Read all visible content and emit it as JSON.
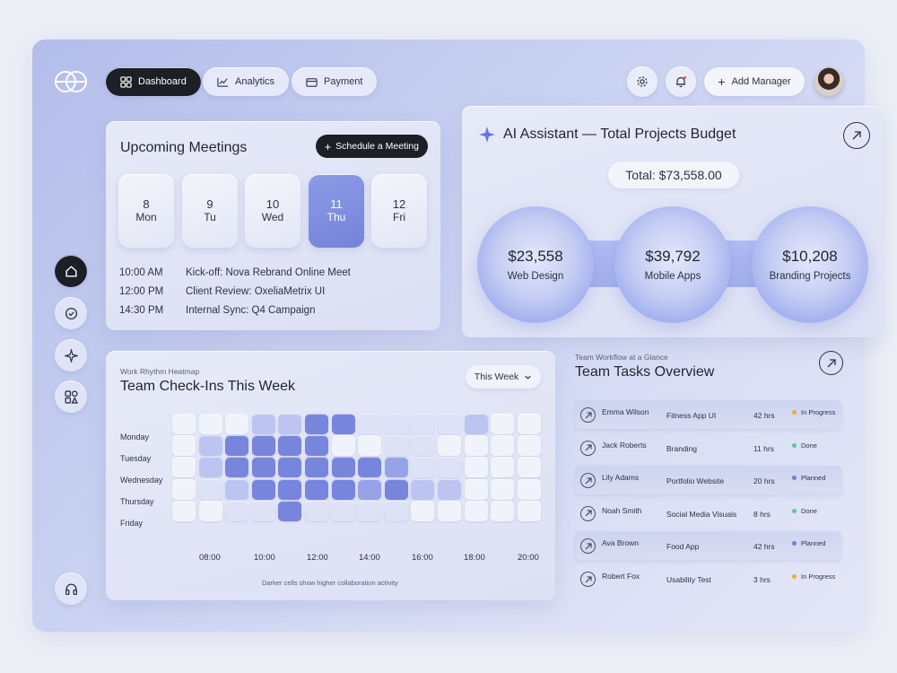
{
  "nav": {
    "dashboard": "Dashboard",
    "analytics": "Analytics",
    "payment": "Payment",
    "add_manager": "Add Manager"
  },
  "meetings": {
    "title": "Upcoming Meetings",
    "schedule_label": "Schedule a Meeting",
    "days": [
      {
        "num": "8",
        "name": "Mon"
      },
      {
        "num": "9",
        "name": "Tu"
      },
      {
        "num": "10",
        "name": "Wed"
      },
      {
        "num": "11",
        "name": "Thu",
        "selected": true
      },
      {
        "num": "12",
        "name": "Fri"
      }
    ],
    "items": [
      {
        "time": "10:00 AM",
        "title": "Kick-off: Nova Rebrand Online Meet"
      },
      {
        "time": "12:00 PM",
        "title": "Client Review: OxeliaMetrix UI"
      },
      {
        "time": "14:30 PM",
        "title": "Internal Sync: Q4 Campaign"
      }
    ]
  },
  "ai": {
    "title": "AI Assistant — Total Projects Budget",
    "total": "Total: $73,558.00",
    "bubbles": [
      {
        "amount": "$23,558",
        "label": "Web Design"
      },
      {
        "amount": "$39,792",
        "label": "Mobile Apps"
      },
      {
        "amount": "$10,208",
        "label": "Branding Projects"
      }
    ]
  },
  "heatmap": {
    "subtitle": "Work Rhythm Heatmap",
    "title": "Team Check-Ins This Week",
    "range": "This Week",
    "days": [
      "Monday",
      "Tuesday",
      "Wednesday",
      "Thursday",
      "Friday"
    ],
    "times": [
      "08:00",
      "10:00",
      "12:00",
      "14:00",
      "16:00",
      "18:00",
      "20:00"
    ],
    "note": "Darker cells show higher collaboration activity",
    "levels": [
      [
        0,
        0,
        0,
        2,
        2,
        4,
        4,
        1,
        1,
        1,
        1,
        2,
        0,
        0
      ],
      [
        0,
        2,
        4,
        4,
        4,
        4,
        0,
        0,
        1,
        1,
        0,
        0,
        0,
        0
      ],
      [
        0,
        2,
        4,
        4,
        4,
        4,
        4,
        4,
        3,
        1,
        1,
        0,
        0,
        0
      ],
      [
        0,
        1,
        2,
        4,
        4,
        4,
        4,
        3,
        4,
        2,
        2,
        0,
        0,
        0
      ],
      [
        0,
        0,
        1,
        1,
        4,
        1,
        1,
        1,
        1,
        0,
        0,
        0,
        0,
        0
      ]
    ],
    "colors": [
      "#f1f3fb",
      "#dde2f7",
      "#bcc5f1",
      "#97a3e8",
      "#7885dc"
    ]
  },
  "tasks": {
    "subtitle": "Team Workflow at a Glance",
    "title": "Team Tasks Overview",
    "rows": [
      {
        "name": "Emma Wilson",
        "project": "Fitness App UI",
        "hours": "42 hrs",
        "status": "In Progress",
        "color": "#f0a93a",
        "shade": true
      },
      {
        "name": "Jack Roberts",
        "project": "Branding",
        "hours": "11 hrs",
        "status": "Done",
        "color": "#4fcf8d",
        "shade": false
      },
      {
        "name": "Lily Adams",
        "project": "Portfolio Website",
        "hours": "20 hrs",
        "status": "Planned",
        "color": "#6c7fe0",
        "shade": true
      },
      {
        "name": "Noah Smith",
        "project": "Social Media Visuals",
        "hours": "8 hrs",
        "status": "Done",
        "color": "#4fcf8d",
        "shade": false
      },
      {
        "name": "Ava Brown",
        "project": "Food App",
        "hours": "42 hrs",
        "status": "Planned",
        "color": "#6c7fe0",
        "shade": true
      },
      {
        "name": "Robert Fox",
        "project": "Usability Test",
        "hours": "3 hrs",
        "status": "In Progress",
        "color": "#f0a93a",
        "shade": false
      }
    ]
  }
}
